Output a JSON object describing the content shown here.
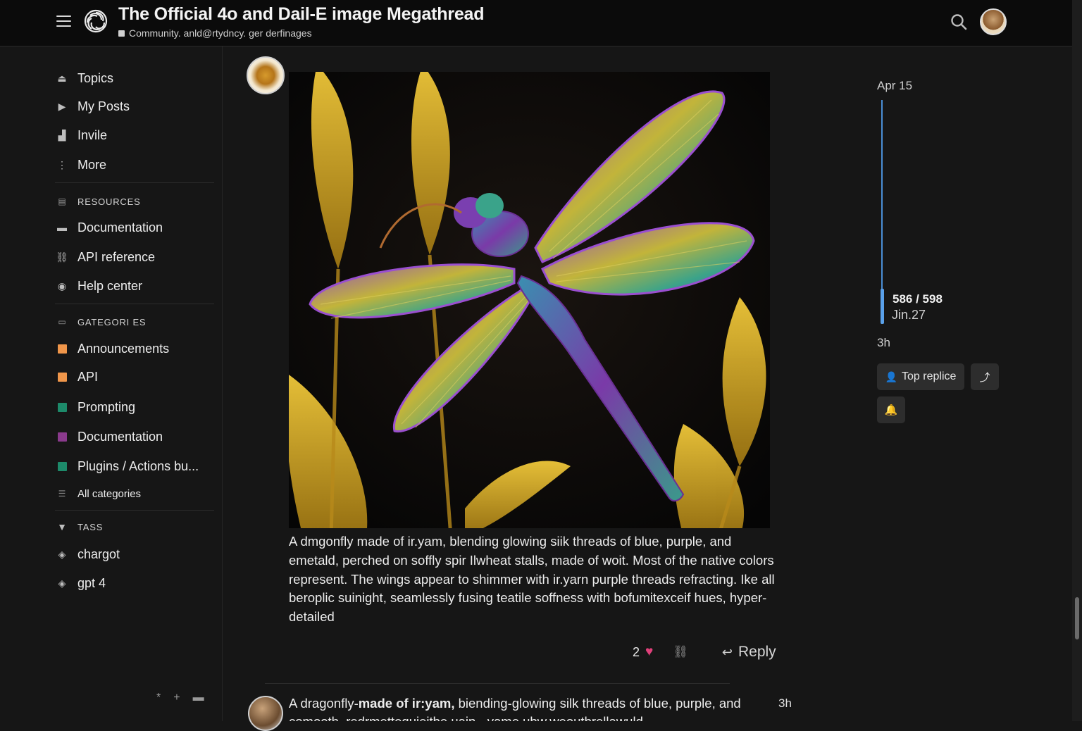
{
  "header": {
    "title": "The Official 4o and Dail-E image Megathread",
    "subtitle": "Community. anld@rtydncy. ger derfinages"
  },
  "sidebar": {
    "nav": [
      {
        "label": "Topics",
        "icon": "topics-icon"
      },
      {
        "label": "My Posts",
        "icon": "play-icon"
      },
      {
        "label": "Invile",
        "icon": "invite-icon"
      },
      {
        "label": "More",
        "icon": "more-icon"
      }
    ],
    "resources_heading": "RESOURCES",
    "resources": [
      {
        "label": "Documentation",
        "icon": "document-icon"
      },
      {
        "label": "API reference",
        "icon": "link-icon"
      },
      {
        "label": "Help center",
        "icon": "help-icon"
      }
    ],
    "categories_heading": "GATEGORI ES",
    "categories": [
      {
        "label": "Announcements",
        "color": "#f0964a"
      },
      {
        "label": "API",
        "color": "#f0964a"
      },
      {
        "label": "Prompting",
        "color": "#1d8a6a"
      },
      {
        "label": "Documentation",
        "color": "#8a3a8c"
      },
      {
        "label": "Plugins / Actions bu...",
        "color": "#1d8a6a"
      }
    ],
    "all_categories": "All categories",
    "tags_heading": "TASS",
    "tags": [
      {
        "label": "chargot"
      },
      {
        "label": "gpt 4"
      }
    ]
  },
  "post": {
    "image_alt": "Dragonfly made of yarn on wheat stalks",
    "text": "A dmgonfly made of ir.yam, blending glowing siik threads of blue, purple, and emetald, perched on soffly spir Ilwheat stalls, made of woit. Most of the native colors represent. The wings appear to shimmer with ir.yarn purple threads refracting. Ike all beroplic suinight, seamlessly fusing teatile soffness with bofumitexceif hues, hyper-detailed",
    "likes": "2",
    "reply_label": "Reply"
  },
  "next_post": {
    "text_lead": "A dragonfly-",
    "text_bold": "made of ir:yam,",
    "text_rest": " biending-glowing silk threads of blue, purple, and",
    "text_line2": "comooth, redrmettequieitbe.uain - vame.ubw.weoutbrellawuld",
    "time": "3h"
  },
  "timeline": {
    "date": "Apr 15",
    "position": "586 / 598",
    "position_date": "Jin.27",
    "ago": "3h",
    "top_replies_label": "Top replice"
  },
  "colors": {
    "accent": "#4a8ed6",
    "heart": "#e0407a"
  }
}
